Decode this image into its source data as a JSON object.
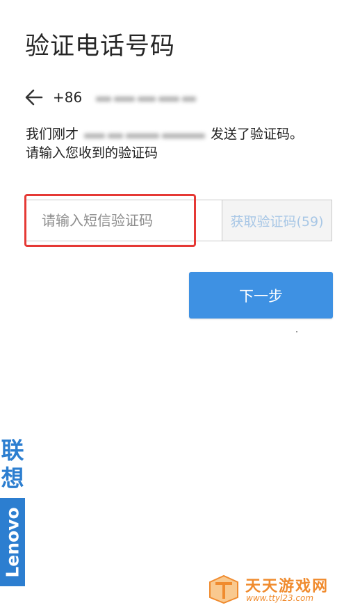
{
  "page": {
    "title": "验证电话号码"
  },
  "phone": {
    "country_code": "+86"
  },
  "description": {
    "line1_prefix": "我们刚才",
    "line1_suffix": "发送了验证码。",
    "line2": "请输入您收到的验证码"
  },
  "code_input": {
    "placeholder": "请输入短信验证码",
    "value": ""
  },
  "get_code_button": {
    "label": "获取验证码(59)",
    "color": "#a8c7e6"
  },
  "next_button": {
    "label": "下一步",
    "color": "#3e91e3"
  },
  "highlight": {
    "color": "#e53935"
  },
  "side_logo": {
    "cn_line1": "联",
    "cn_line2": "想",
    "en": "Lenovo",
    "color": "#2c7ed0"
  },
  "watermark": {
    "title": "天天游戏网",
    "url": "www.ttyl23.com",
    "color": "#f08b2e"
  }
}
